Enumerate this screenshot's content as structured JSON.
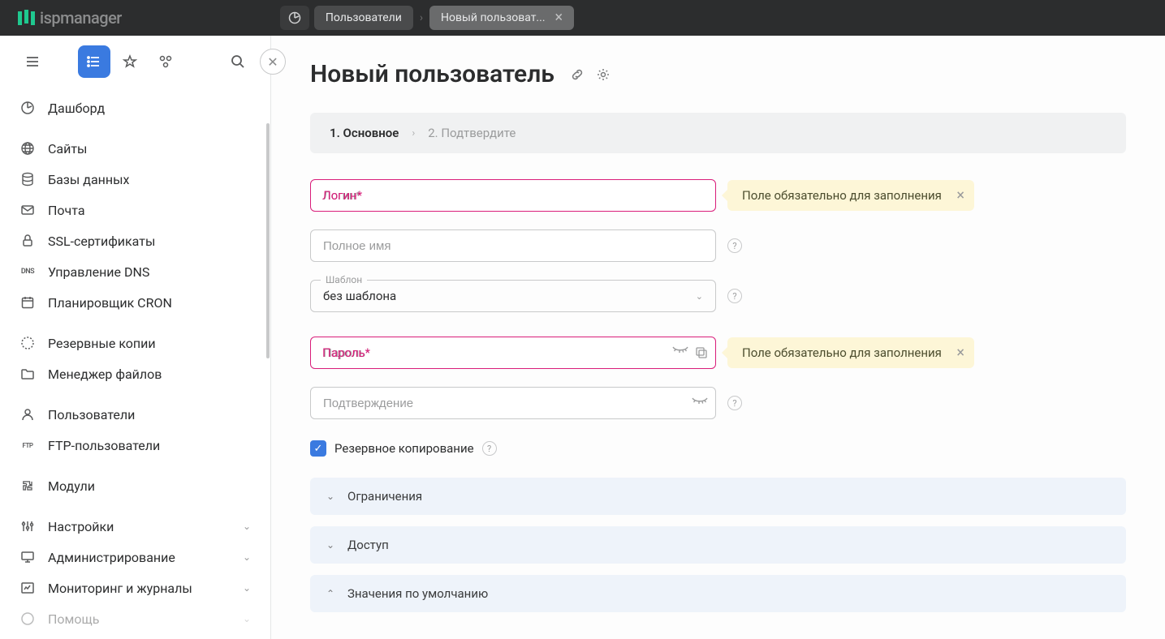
{
  "app_name": "ispmanager",
  "breadcrumb": {
    "tab1": "Пользователи",
    "tab2": "Новый пользоват..."
  },
  "sidebar": {
    "items": [
      {
        "label": "Дашборд",
        "icon": "dashboard-icon"
      },
      {
        "label": "Сайты",
        "icon": "globe-icon"
      },
      {
        "label": "Базы данных",
        "icon": "database-icon"
      },
      {
        "label": "Почта",
        "icon": "mail-icon"
      },
      {
        "label": "SSL-сертификаты",
        "icon": "lock-icon"
      },
      {
        "label": "Управление DNS",
        "icon": "dns-icon"
      },
      {
        "label": "Планировщик CRON",
        "icon": "calendar-icon"
      },
      {
        "label": "Резервные копии",
        "icon": "backup-icon"
      },
      {
        "label": "Менеджер файлов",
        "icon": "folder-icon"
      },
      {
        "label": "Пользователи",
        "icon": "user-icon"
      },
      {
        "label": "FTP-пользователи",
        "icon": "ftp-icon"
      },
      {
        "label": "Модули",
        "icon": "puzzle-icon"
      },
      {
        "label": "Настройки",
        "icon": "sliders-icon",
        "expandable": true
      },
      {
        "label": "Администрирование",
        "icon": "monitor-icon",
        "expandable": true
      },
      {
        "label": "Мониторинг и журналы",
        "icon": "chart-icon",
        "expandable": true
      },
      {
        "label": "Помощь",
        "icon": "help-icon",
        "expandable": true
      }
    ]
  },
  "page": {
    "title": "Новый пользователь",
    "steps": {
      "step1": "1. Основное",
      "step2": "2. Подтвердите"
    }
  },
  "form": {
    "login_placeholder": "Логин*",
    "fullname_placeholder": "Полное имя",
    "template_label": "Шаблон",
    "template_value": "без шаблона",
    "password_placeholder": "Пароль*",
    "confirm_placeholder": "Подтверждение",
    "backup_label": "Резервное копирование",
    "backup_checked": true
  },
  "errors": {
    "login": "Поле обязательно для заполнения",
    "password": "Поле обязательно для заполнения"
  },
  "collapsibles": {
    "limits": "Ограничения",
    "access": "Доступ",
    "defaults": "Значения по умолчанию"
  }
}
